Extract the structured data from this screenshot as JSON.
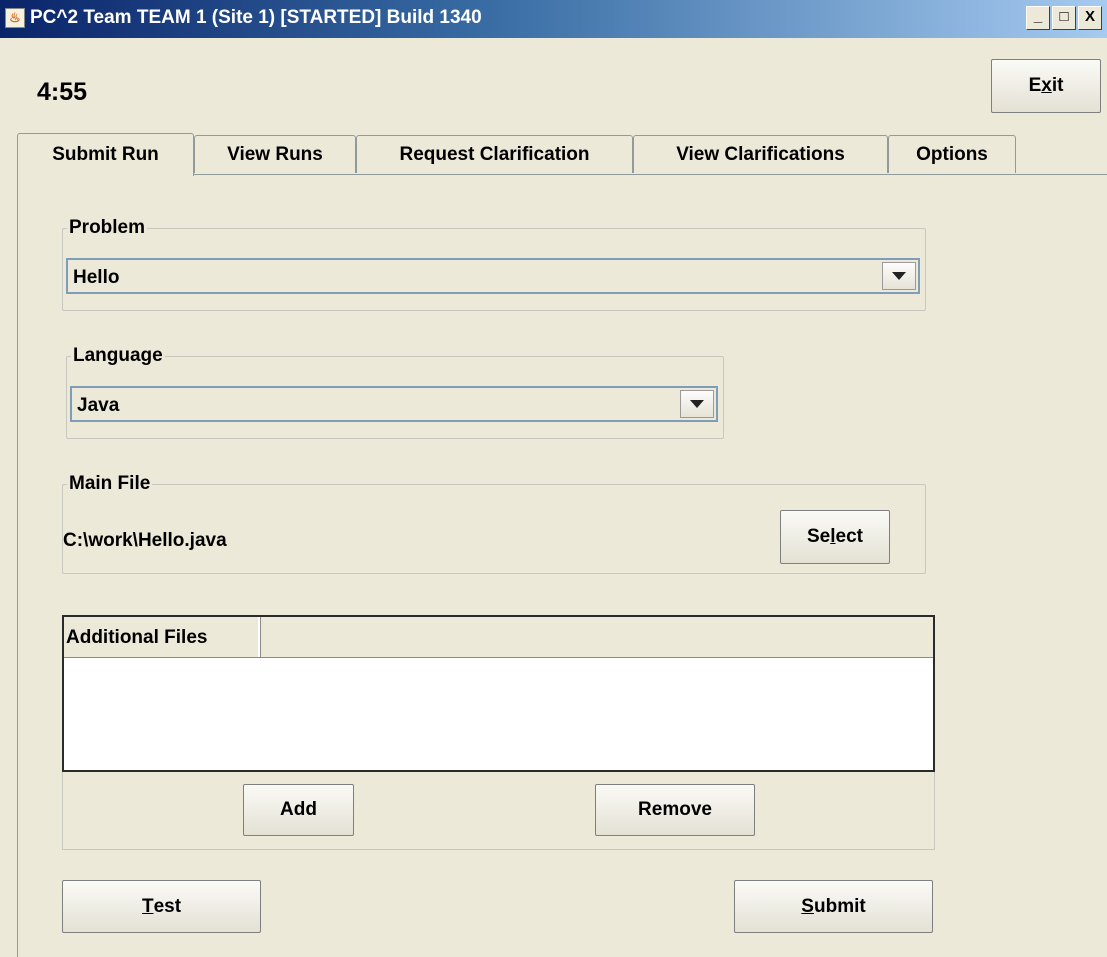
{
  "window": {
    "title": "PC^2 Team TEAM 1 (Site 1) [STARTED] Build 1340",
    "controls": [
      "_",
      "□",
      "X"
    ]
  },
  "header": {
    "timer": "4:55",
    "exit_label_pre": "E",
    "exit_label_mnemonic": "x",
    "exit_label_post": "it"
  },
  "tabs": [
    {
      "label": "Submit Run",
      "active": true
    },
    {
      "label": "View Runs",
      "active": false
    },
    {
      "label": "Request Clarification",
      "active": false
    },
    {
      "label": "View Clarifications",
      "active": false
    },
    {
      "label": "Options",
      "active": false
    }
  ],
  "submit": {
    "problem": {
      "legend": "Problem",
      "value": "Hello"
    },
    "language": {
      "legend": "Language",
      "value": "Java"
    },
    "main_file": {
      "legend": "Main File",
      "path": "C:\\work\\Hello.java",
      "select_pre": "Se",
      "select_mnemonic": "l",
      "select_post": "ect"
    },
    "additional_files": {
      "header": "Additional Files",
      "rows": [],
      "add_label": "Add",
      "remove_label": "Remove"
    },
    "test_mnemonic": "T",
    "test_rest": "est",
    "submit_mnemonic": "S",
    "submit_rest": "ubmit"
  },
  "colors": {
    "window_bg": "#ece9d8",
    "title_gradient_start": "#0a246a",
    "title_gradient_end": "#a6caf0"
  }
}
